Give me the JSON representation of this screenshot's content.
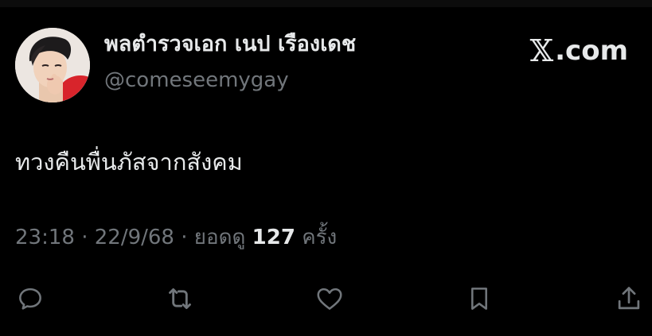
{
  "author": {
    "display_name": "พลตำรวจเอก เนป เรืองเดช",
    "handle": "@comeseemygay",
    "avatar": "profile-photo"
  },
  "brand": {
    "glyph": "𝕏",
    "domain": ".com"
  },
  "tweet": {
    "text": "ทวงคืนพื่นภัสจากสังคม"
  },
  "meta": {
    "time": "23:18",
    "sep1": " · ",
    "date": "22/9/68",
    "sep2": " · ",
    "views_label": "ยอดดู",
    "views_count": "127",
    "views_unit": "ครั้ง"
  },
  "actions": [
    {
      "name": "reply",
      "icon": "reply-icon"
    },
    {
      "name": "repost",
      "icon": "repost-icon"
    },
    {
      "name": "like",
      "icon": "heart-icon"
    },
    {
      "name": "bookmark",
      "icon": "bookmark-icon"
    },
    {
      "name": "share",
      "icon": "share-icon"
    }
  ],
  "colors": {
    "background": "#000000",
    "primary_text": "#e7e9ea",
    "secondary_text": "#71767b"
  }
}
